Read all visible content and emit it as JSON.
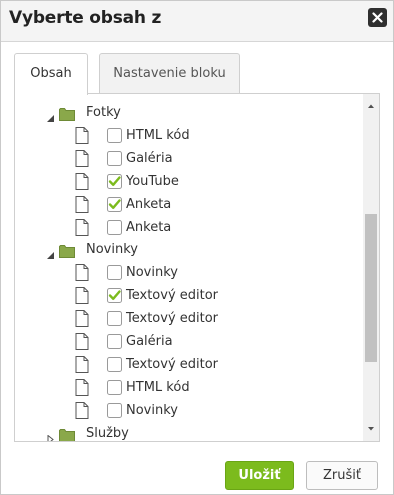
{
  "dialog": {
    "title": "Vyberte obsah z"
  },
  "tabs": [
    {
      "label": "Obsah",
      "active": true
    },
    {
      "label": "Nastavenie bloku",
      "active": false
    }
  ],
  "tree": {
    "rows": [
      {
        "type": "folder",
        "label": "Fotky",
        "expanded": true
      },
      {
        "type": "item",
        "label": "HTML kód",
        "checked": false
      },
      {
        "type": "item",
        "label": "Galéria",
        "checked": false
      },
      {
        "type": "item",
        "label": "YouTube",
        "checked": true
      },
      {
        "type": "item",
        "label": "Anketa",
        "checked": true
      },
      {
        "type": "item",
        "label": "Anketa",
        "checked": false
      },
      {
        "type": "folder",
        "label": "Novinky",
        "expanded": true
      },
      {
        "type": "item",
        "label": "Novinky",
        "checked": false
      },
      {
        "type": "item",
        "label": "Textový editor",
        "checked": true
      },
      {
        "type": "item",
        "label": "Textový editor",
        "checked": false
      },
      {
        "type": "item",
        "label": "Galéria",
        "checked": false
      },
      {
        "type": "item",
        "label": "Textový editor",
        "checked": false
      },
      {
        "type": "item",
        "label": "HTML kód",
        "checked": false
      },
      {
        "type": "item",
        "label": "Novinky",
        "checked": false
      },
      {
        "type": "folder",
        "label": "Služby",
        "expanded": false
      }
    ]
  },
  "footer": {
    "save_label": "Uložiť",
    "cancel_label": "Zrušiť"
  },
  "colors": {
    "accent": "#7cbb1d",
    "folder": "#8aa84a",
    "titlebar": "#f4f4f4"
  }
}
